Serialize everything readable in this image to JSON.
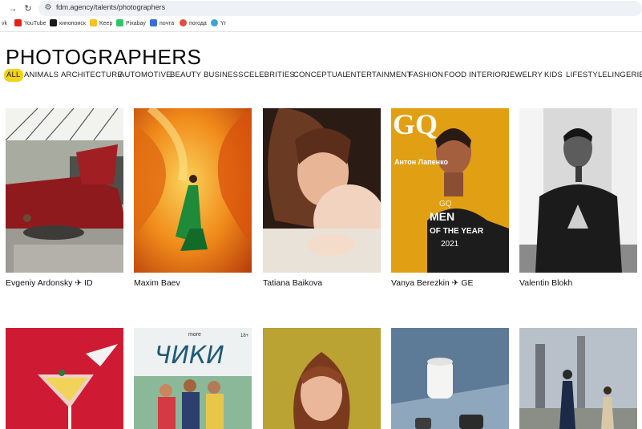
{
  "browser": {
    "url": "fdm.agency/talents/photographers",
    "bookmarks": [
      "vk",
      "YouTube",
      "кинопоиск",
      "Keep",
      "Pixabay",
      "почта",
      "погода",
      "Yr"
    ]
  },
  "page": {
    "title": "PHOTOGRAPHERS",
    "filters": [
      "ALL",
      "ANIMALS",
      "ARCHITECTURE",
      "AUTOMOTIVE",
      "BEAUTY",
      "BUSINESS",
      "CELEBRITIES",
      "CONCEPTUAL",
      "ENTERTAINMENT",
      "FASHION",
      "FOOD",
      "INTERIOR",
      "JEWELRY",
      "KIDS",
      "LIFESTYLE",
      "LINGERIE"
    ],
    "active_filter": "ALL"
  },
  "photographers": [
    {
      "name": "Evgeniy Ardonsky ✈ ID"
    },
    {
      "name": "Maxim Baev"
    },
    {
      "name": "Tatiana Baikova"
    },
    {
      "name": "Vanya Berezkin ✈ GE"
    },
    {
      "name": "Valentin Blokh"
    }
  ],
  "cover_text": {
    "gq_logo": "GQ",
    "gq_name": "Антон Лапенко",
    "gq_men": "MEN",
    "gq_of_the_year": "OF THE YEAR",
    "gq_year": "2021",
    "chiki_brand": "more",
    "chiki_title": "ЧИКИ",
    "chiki_rating": "18+"
  }
}
